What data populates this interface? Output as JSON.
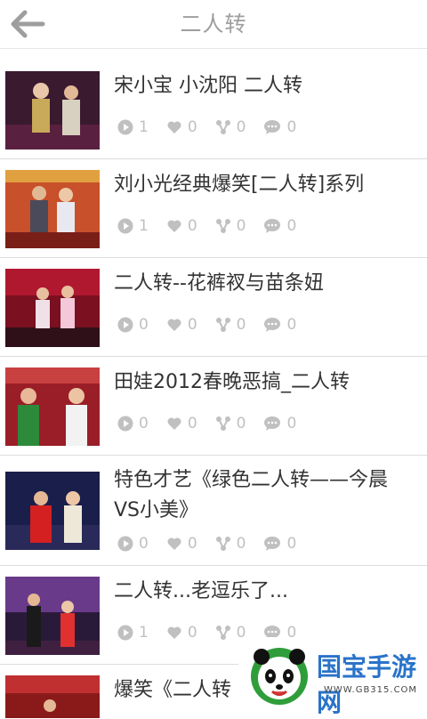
{
  "header": {
    "title": "二人转",
    "back_icon": "back-arrow-icon"
  },
  "items": [
    {
      "title": "宋小宝 小沈阳 二人转",
      "plays": "1",
      "likes": "0",
      "shares": "0",
      "comments": "0"
    },
    {
      "title": "刘小光经典爆笑[二人转]系列",
      "plays": "1",
      "likes": "0",
      "shares": "0",
      "comments": "0"
    },
    {
      "title": "二人转--花裤衩与苗条妞",
      "plays": "0",
      "likes": "0",
      "shares": "0",
      "comments": "0"
    },
    {
      "title": "田娃2012春晚恶搞_二人转",
      "plays": "0",
      "likes": "0",
      "shares": "0",
      "comments": "0"
    },
    {
      "title": "特色才艺《绿色二人转——今晨VS小美》",
      "plays": "0",
      "likes": "0",
      "shares": "0",
      "comments": "0"
    },
    {
      "title": "二人转...老逗乐了...",
      "plays": "1",
      "likes": "0",
      "shares": "0",
      "comments": "0"
    },
    {
      "title": "爆笑《二人转",
      "plays": "",
      "likes": "",
      "shares": "",
      "comments": ""
    }
  ],
  "watermark": {
    "name": "国宝手游网",
    "url": "WWW.GB315.COM"
  },
  "colors": {
    "title_gray": "#9e9e9e",
    "stat_gray": "#c0c0c0",
    "text": "#333333"
  }
}
